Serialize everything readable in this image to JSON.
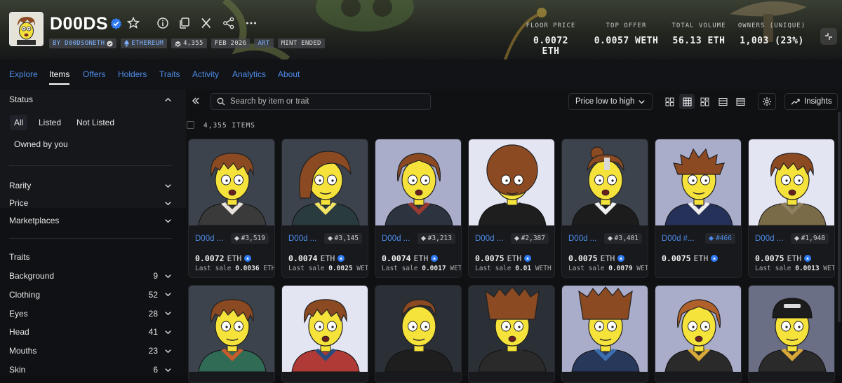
{
  "header": {
    "title": "D00DS",
    "chips": [
      {
        "label": "BY D00DSONETH",
        "style": "blue",
        "icon": "verified-icon"
      },
      {
        "label": "ETHEREUM",
        "style": "blue",
        "icon": "ethereum-icon"
      },
      {
        "label": "4,355",
        "style": "normal",
        "icon": "stack-icon"
      },
      {
        "label": "FEB 2026",
        "style": "normal"
      },
      {
        "label": "ART",
        "style": "blue"
      },
      {
        "label": "MINT ENDED",
        "style": "normal"
      }
    ],
    "stats": [
      {
        "label": "FLOOR PRICE",
        "value": "0.0072 ETH"
      },
      {
        "label": "TOP OFFER",
        "value": "0.0057 WETH"
      },
      {
        "label": "TOTAL VOLUME",
        "value": "56.13 ETH"
      },
      {
        "label": "OWNERS (UNIQUE)",
        "value": "1,003 (23%)"
      }
    ],
    "icons": [
      "star-icon",
      "info-icon",
      "copy-icon",
      "x-icon",
      "share-icon",
      "more-icon"
    ]
  },
  "nav": {
    "tabs": [
      "Explore",
      "Items",
      "Offers",
      "Holders",
      "Traits",
      "Activity",
      "Analytics",
      "About"
    ],
    "active": "Items"
  },
  "sidebar": {
    "status_label": "Status",
    "status_filters": [
      "All",
      "Listed",
      "Not Listed"
    ],
    "owned_label": "Owned by you",
    "rarity_label": "Rarity",
    "price_label": "Price",
    "marketplaces_label": "Marketplaces",
    "traits_label": "Traits",
    "traits": [
      {
        "name": "Background",
        "count": "9"
      },
      {
        "name": "Clothing",
        "count": "52"
      },
      {
        "name": "Eyes",
        "count": "28"
      },
      {
        "name": "Head",
        "count": "41"
      },
      {
        "name": "Mouths",
        "count": "23"
      },
      {
        "name": "Skin",
        "count": "6"
      }
    ]
  },
  "toolbar": {
    "search_placeholder": "Search by item or trait",
    "sort_label": "Price low to high",
    "insights_label": "Insights",
    "items_count": "4,355 ITEMS"
  },
  "colors": {
    "accent": "#4d8ce8",
    "background": "#0f0f11",
    "skin": "#f5e23a"
  },
  "cards": [
    {
      "name": "D00d ...",
      "id": "#3,519",
      "price": "0.0072",
      "unit": "ETH",
      "last_label": "Last sale",
      "last_value": "0.0036",
      "last_unit": "ETH",
      "bg": "#3d434c",
      "hair": "#8b4a22",
      "style": "shaggy",
      "shirt": "#3a3a3a",
      "collar": "#e8e4dc"
    },
    {
      "name": "D00d ...",
      "id": "#3,145",
      "price": "0.0074",
      "unit": "ETH",
      "last_label": "Last sale",
      "last_value": "0.0025",
      "last_unit": "WETH",
      "bg": "#3d434c",
      "hair": "#8b4a22",
      "style": "swoop",
      "shirt": "#2a3b3f",
      "collar": "#f2e566"
    },
    {
      "name": "D00d ...",
      "id": "#3,213",
      "price": "0.0074",
      "unit": "ETH",
      "last_label": "Last sale",
      "last_value": "0.0017",
      "last_unit": "WETH",
      "bg": "#a9adc9",
      "hair": "#8b4a22",
      "style": "long",
      "shirt": "#2c3440",
      "collar": "#9a3a30"
    },
    {
      "name": "D00d ...",
      "id": "#2,387",
      "price": "0.0075",
      "unit": "ETH",
      "last_label": "Last sale",
      "last_value": "0.01",
      "last_unit": "WETH",
      "bg": "#e4e5f2",
      "hair": "#8b4a22",
      "style": "afro",
      "shirt": "#1e1e1e",
      "collar": "#1e1e1e"
    },
    {
      "name": "D00d ...",
      "id": "#3,401",
      "price": "0.0075",
      "unit": "ETH",
      "last_label": "Last sale",
      "last_value": "0.0079",
      "last_unit": "WETH",
      "bg": "#3d434c",
      "hair": "#8b4a22",
      "style": "bun",
      "shirt": "#1c1c1c",
      "collar": "#efefef"
    },
    {
      "name": "D00d #...",
      "id": "#466",
      "rare": true,
      "price": "0.0075",
      "unit": "ETH",
      "last_label": "",
      "last_value": "",
      "last_unit": "",
      "bg": "#a9adc9",
      "hair": "#8b4a22",
      "style": "spiky",
      "shirt": "#26315a",
      "collar": "#efefef"
    },
    {
      "name": "D00d ...",
      "id": "#1,948",
      "price": "0.0075",
      "unit": "ETH",
      "last_label": "Last sale",
      "last_value": "0.0013",
      "last_unit": "WETH",
      "bg": "#e4e5f2",
      "hair": "#8b4a22",
      "style": "shaggy",
      "shirt": "#7a6b48",
      "collar": "#8e8160"
    },
    {
      "bg": "#3d434c",
      "hair": "#8b4a22",
      "style": "shaggy",
      "shirt": "#2f6b55",
      "collar": "#c45c2c"
    },
    {
      "bg": "#e4e5f2",
      "hair": "#8b4a22",
      "style": "shaggy",
      "shirt": "#b03a36",
      "collar": "#2c4a7a"
    },
    {
      "bg": "#2b2f36",
      "hair": "#8b4a22",
      "style": "short",
      "shirt": "#1e1e1e",
      "collar": "#1e1e1e"
    },
    {
      "bg": "#2b2f36",
      "hair": "#8b4a22",
      "style": "flat",
      "shirt": "#2a2a2a",
      "collar": "#2a2a2a"
    },
    {
      "bg": "#a9adc9",
      "hair": "#8b4a22",
      "style": "flat",
      "shirt": "#27385a",
      "collar": "#3c6fb0"
    },
    {
      "bg": "#a9adc9",
      "hair": "#b0602a",
      "style": "long",
      "shirt": "#2a2a2a",
      "collar": "#d8a838"
    },
    {
      "bg": "#6b6f86",
      "hair": "#1e1e1e",
      "style": "cap",
      "shirt": "#2a2a2a",
      "collar": "#d8a838"
    }
  ]
}
